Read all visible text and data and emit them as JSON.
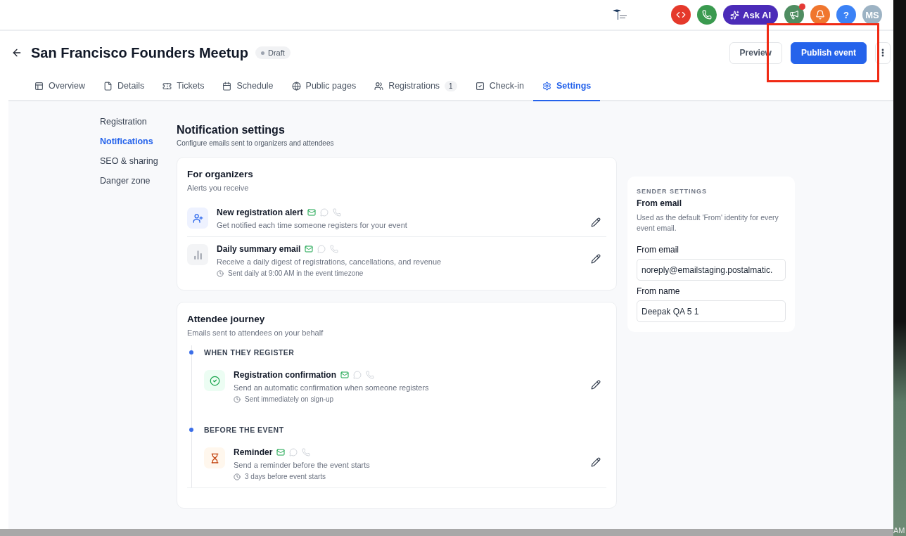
{
  "header": {
    "actions": [
      {
        "kind": "code",
        "color": "#e5392b"
      },
      {
        "kind": "phone",
        "color": "#3a9a4f"
      },
      {
        "kind": "ask_ai",
        "label": "Ask AI",
        "color": "#4b2bb8"
      },
      {
        "kind": "megaphone",
        "color": "#4f8d61",
        "dot": true
      },
      {
        "kind": "bell",
        "color": "#f0762e"
      },
      {
        "kind": "help",
        "label": "?",
        "color": "#3b82f6"
      },
      {
        "kind": "avatar",
        "label": "MS",
        "color": "#9db3c4"
      }
    ]
  },
  "event": {
    "title": "San Francisco Founders Meetup",
    "status": "Draft",
    "preview": "Preview",
    "publish": "Publish event"
  },
  "tabs": [
    {
      "label": "Overview",
      "selected": false
    },
    {
      "label": "Details",
      "selected": false
    },
    {
      "label": "Tickets",
      "selected": false
    },
    {
      "label": "Schedule",
      "selected": false
    },
    {
      "label": "Public pages",
      "selected": false
    },
    {
      "label": "Registrations",
      "count": "1",
      "selected": false
    },
    {
      "label": "Check-in",
      "selected": false
    },
    {
      "label": "Settings",
      "selected": true
    }
  ],
  "sidebar": {
    "items": [
      {
        "label": "Registration",
        "selected": false
      },
      {
        "label": "Notifications",
        "selected": true
      },
      {
        "label": "SEO & sharing",
        "selected": false
      },
      {
        "label": "Danger zone",
        "selected": false
      }
    ]
  },
  "section": {
    "title": "Notification settings",
    "subtitle": "Configure emails sent to organizers and attendees"
  },
  "organizers": {
    "title": "For organizers",
    "subtitle": "Alerts you receive",
    "items": [
      {
        "title": "New registration alert",
        "description": "Get notified each time someone registers for your event",
        "channels": [
          {
            "kind": "email",
            "on": true
          },
          {
            "kind": "chat",
            "on": false
          },
          {
            "kind": "whatsapp",
            "on": false
          }
        ]
      },
      {
        "title": "Daily summary email",
        "description": "Receive a daily digest of registrations, cancellations, and revenue",
        "timing": "Sent daily at 9:00 AM in the event timezone",
        "channels": [
          {
            "kind": "email",
            "on": true
          },
          {
            "kind": "chat",
            "on": false
          },
          {
            "kind": "whatsapp",
            "on": false
          }
        ]
      }
    ]
  },
  "journey": {
    "title": "Attendee journey",
    "subtitle": "Emails sent to attendees on your behalf",
    "stages": [
      {
        "label": "WHEN THEY REGISTER",
        "items": [
          {
            "title": "Registration confirmation",
            "description": "Send an automatic confirmation when someone registers",
            "timing": "Sent immediately on sign-up",
            "channels": [
              {
                "kind": "email",
                "on": true
              },
              {
                "kind": "chat",
                "on": false
              },
              {
                "kind": "whatsapp",
                "on": false
              }
            ]
          }
        ]
      },
      {
        "label": "BEFORE THE EVENT",
        "items": [
          {
            "title": "Reminder",
            "description": "Send a reminder before the event starts",
            "timing": "3 days before event starts",
            "channels": [
              {
                "kind": "email",
                "on": true
              },
              {
                "kind": "chat",
                "on": false
              },
              {
                "kind": "whatsapp",
                "on": false
              }
            ]
          }
        ]
      }
    ]
  },
  "sender": {
    "eyebrow": "SENDER SETTINGS",
    "title": "From email",
    "description": "Used as the default 'From' identity for every event email.",
    "fields": [
      {
        "label": "From email",
        "value": "noreply@emailstaging.postalmatic."
      },
      {
        "label": "From name",
        "value": "Deepak QA 5 1"
      }
    ]
  },
  "desktop": {
    "clock": "AM"
  }
}
